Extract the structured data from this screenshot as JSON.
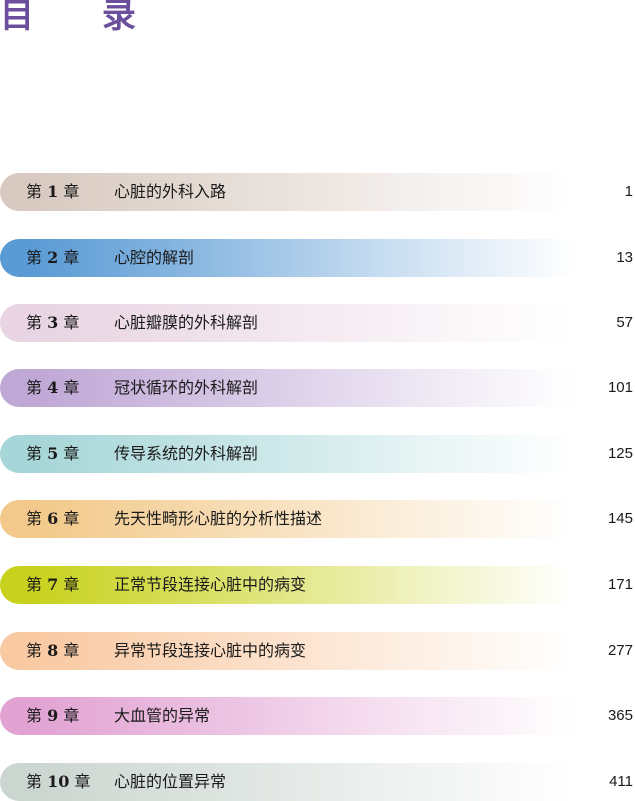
{
  "title": "目 录",
  "chapters": [
    {
      "prefix": "第 ",
      "num": "1",
      "suffix": " 章",
      "heading": "心脏的外科入路",
      "page": "1",
      "color": "#d8cac0"
    },
    {
      "prefix": "第 ",
      "num": "2",
      "suffix": " 章",
      "heading": "心腔的解剖",
      "page": "13",
      "color": "#5b9bd5"
    },
    {
      "prefix": "第 ",
      "num": "3",
      "suffix": " 章",
      "heading": "心脏瓣膜的外科解剖",
      "page": "57",
      "color": "#e8d4e2"
    },
    {
      "prefix": "第 ",
      "num": "4",
      "suffix": " 章",
      "heading": "冠状循环的外科解剖",
      "page": "101",
      "color": "#bfa7d6"
    },
    {
      "prefix": "第 ",
      "num": "5",
      "suffix": " 章",
      "heading": "传导系统的外科解剖",
      "page": "125",
      "color": "#a7d6d8"
    },
    {
      "prefix": "第 ",
      "num": "6",
      "suffix": " 章",
      "heading": "先天性畸形心脏的分析性描述",
      "page": "145",
      "color": "#f2c98a"
    },
    {
      "prefix": "第 ",
      "num": "7",
      "suffix": " 章",
      "heading": "正常节段连接心脏中的病变",
      "page": "171",
      "color": "#c8d21e"
    },
    {
      "prefix": "第 ",
      "num": "8",
      "suffix": " 章",
      "heading": "异常节段连接心脏中的病变",
      "page": "277",
      "color": "#f9c9a2"
    },
    {
      "prefix": "第 ",
      "num": "9",
      "suffix": " 章",
      "heading": "大血管的异常",
      "page": "365",
      "color": "#e2a3d3"
    },
    {
      "prefix": "第 ",
      "num": "10",
      "suffix": " 章",
      "heading": "心脏的位置异常",
      "page": "411",
      "color": "#ccd6d0"
    }
  ]
}
